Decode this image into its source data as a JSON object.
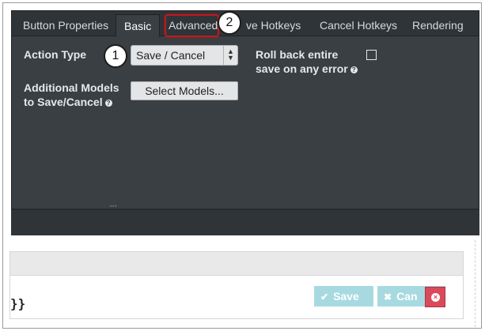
{
  "tabs": [
    {
      "label": "Button Properties",
      "active": false
    },
    {
      "label": "Basic",
      "active": true
    },
    {
      "label": "Advanced",
      "active": false
    },
    {
      "label": "Save Hotkeys",
      "active": false
    },
    {
      "label": "Cancel Hotkeys",
      "active": false
    },
    {
      "label": "Rendering",
      "active": false
    }
  ],
  "visible_tab_text": {
    "save_hotkeys_partial": "ve Hotkeys"
  },
  "form": {
    "action_type_label": "Action Type",
    "action_type_value": "Save / Cancel",
    "additional_models_label_line1": "Additional Models",
    "additional_models_label_line2": "to Save/Cancel",
    "select_models_button": "Select Models...",
    "rollback_label_line1": "Roll back entire",
    "rollback_label_line2": "save on any error",
    "rollback_checked": false,
    "help_glyph": "?"
  },
  "callouts": [
    {
      "number": "1"
    },
    {
      "number": "2"
    }
  ],
  "preview": {
    "braces_text": "}}",
    "save_label": "Save",
    "cancel_label": "Can",
    "save_icon": "check-icon",
    "cancel_icon": "x-icon",
    "delete_icon": "x-circle-icon"
  },
  "colors": {
    "panel_bg": "#3a3f44",
    "highlight": "#c0191f",
    "preview_button": "#a7dae0",
    "delete_button": "#d94a5a"
  }
}
